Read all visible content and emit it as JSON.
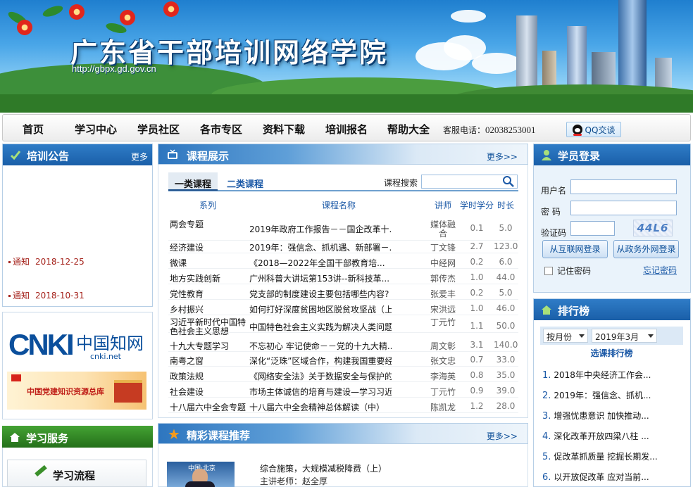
{
  "header": {
    "title": "广东省干部培训网络学院",
    "url": "http://gbpx.gd.gov.cn"
  },
  "nav": {
    "items": [
      "首页",
      "学习中心",
      "学员社区",
      "各市专区",
      "资料下载",
      "培训报名",
      "帮助大全"
    ],
    "hotline_label": "客服电话：",
    "hotline_number": "02038253001",
    "qq_label": "QQ交谈"
  },
  "notices": {
    "title": "培训公告",
    "more": "更多",
    "items": [
      {
        "type": "通知",
        "date": "2018-12-25"
      },
      {
        "type": "通知",
        "date": "2018-10-31"
      }
    ]
  },
  "courses": {
    "title": "课程展示",
    "more": "更多>>",
    "tabs": [
      "一类课程",
      "二类课程"
    ],
    "search_label": "课程搜索",
    "columns": {
      "category": "系列",
      "name": "课程名称",
      "lecturer": "讲师",
      "hours": "学时学分",
      "length": "时长"
    },
    "rows": [
      {
        "category": "两会专题",
        "name": "2019年政府工作报告－－国企改革十...",
        "lecturer": "媒体融合",
        "hours": "0.1",
        "length": "5.0"
      },
      {
        "category": "经济建设",
        "name": "2019年：强信念、抓机遇、新部署－...",
        "lecturer": "丁文锋",
        "hours": "2.7",
        "length": "123.0"
      },
      {
        "category": "微课",
        "name": "《2018—2022年全国干部教育培...",
        "lecturer": "中经网",
        "hours": "0.2",
        "length": "6.0"
      },
      {
        "category": "地方实践创新",
        "name": "广州科普大讲坛第153讲--新科技革...",
        "lecturer": "郭传杰",
        "hours": "1.0",
        "length": "44.0"
      },
      {
        "category": "党性教育",
        "name": "党支部的制度建设主要包括哪些内容?",
        "lecturer": "张爱丰",
        "hours": "0.2",
        "length": "5.0"
      },
      {
        "category": "乡村振兴",
        "name": "如何打好深度贫困地区脱贫攻坚战（上）",
        "lecturer": "宋洪远",
        "hours": "1.0",
        "length": "46.0"
      },
      {
        "category": "习近平新时代中国特色社会主义思想",
        "name": "中国特色社会主义实践为解决人类问题贡...",
        "lecturer": "丁元竹",
        "hours": "1.1",
        "length": "50.0"
      },
      {
        "category": "十九大专题学习",
        "name": "不忘初心 牢记使命－－党的十九大精...",
        "lecturer": "周文彰",
        "hours": "3.1",
        "length": "140.0"
      },
      {
        "category": "南粤之窗",
        "name": "深化“泛珠”区域合作，构建我国重要经...",
        "lecturer": "张文忠",
        "hours": "0.7",
        "length": "33.0"
      },
      {
        "category": "政策法规",
        "name": "《网络安全法》关于数据安全与保护的法...",
        "lecturer": "李海英",
        "hours": "0.8",
        "length": "35.0"
      },
      {
        "category": "社会建设",
        "name": "市场主体诚信的培育与建设—学习习近平...",
        "lecturer": "丁元竹",
        "hours": "0.9",
        "length": "39.0"
      },
      {
        "category": "十八届六中全会专题",
        "name": "十八届六中全会精神总体解读（中）",
        "lecturer": "陈凯龙",
        "hours": "1.2",
        "length": "28.0"
      }
    ]
  },
  "recommend": {
    "title": "精彩课程推荐",
    "more": "更多>>",
    "thumb_tag": "中国·北京",
    "course_title": "综合施策，大规模减税降费（上）",
    "teacher": "主讲老师：赵全厚"
  },
  "ads": {
    "cnki_cn": "中国知网",
    "cnki_en": "cnki.net",
    "party_text": "中国党建知识资源总库"
  },
  "service": {
    "title": "学习服务",
    "flow_button": "学习流程"
  },
  "login": {
    "title": "学员登录",
    "username_label": "用户名",
    "password_label": "密 码",
    "captcha_label": "验证码",
    "captcha_text": "44L6",
    "internet_button": "从互联网登录",
    "gov_button": "从政务外网登录",
    "remember_label": "记住密码",
    "forgot_link": "忘记密码"
  },
  "ranking": {
    "title": "排行榜",
    "filter_mode": "按月份",
    "filter_month": "2019年3月",
    "subtitle": "选课排行榜",
    "items": [
      "2018年中央经济工作会...",
      "2019年：强信念、抓机...",
      "增强忧患意识 加快推动...",
      "深化改革开放四梁八柱 ...",
      "促改革抓质量 挖掘长期发...",
      "以开放促改革 应对当前..."
    ]
  }
}
